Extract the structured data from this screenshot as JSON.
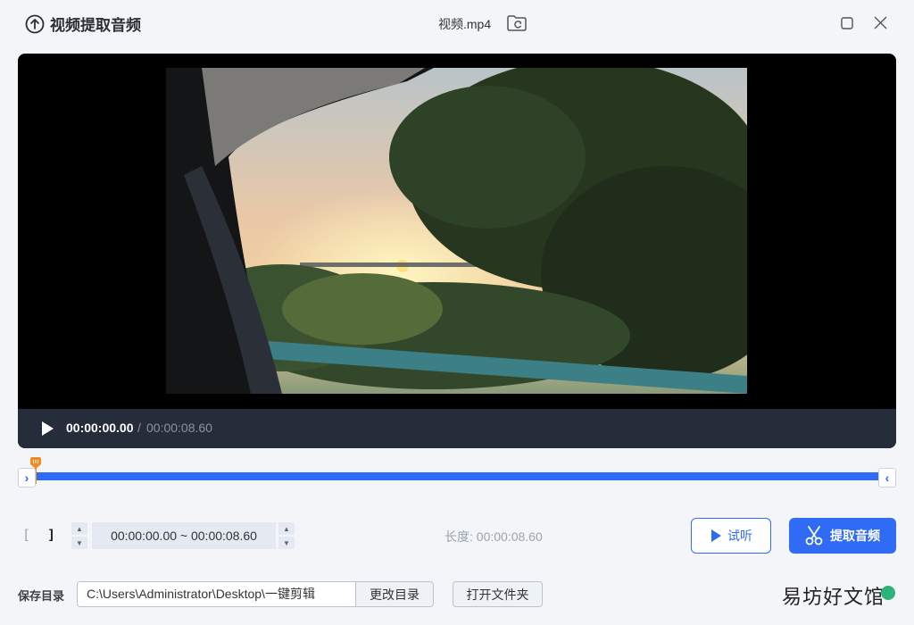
{
  "app": {
    "title": "视频提取音频",
    "file_name": "视频.mp4",
    "icons": {
      "title": "upload-circle-icon",
      "folder": "folder-refresh-icon",
      "maximize": "maximize-icon",
      "close": "close-icon"
    }
  },
  "player": {
    "current_time": "00:00:00.00",
    "separator": "/",
    "total_time": "00:00:08.60",
    "play_icon": "play-icon"
  },
  "timeline": {
    "start_handle": "›",
    "end_handle": "‹",
    "marker_icon": "playhead-marker-icon",
    "track_color": "#2f6bf4",
    "marker_color": "#f08a24"
  },
  "range": {
    "start_bracket": "[",
    "end_bracket": "]",
    "value": "00:00:00.00 ~ 00:00:08.60",
    "length_label": "长度: 00:00:08.60"
  },
  "actions": {
    "preview_label": "试听",
    "extract_label": "提取音频",
    "preview_icon": "play-outline-icon",
    "extract_icon": "scissors-icon"
  },
  "save": {
    "label": "保存目录",
    "path": "C:\\Users\\Administrator\\Desktop\\一键剪辑",
    "change_button": "更改目录",
    "open_button": "打开文件夹"
  },
  "watermark": {
    "text": "易坊好文馆"
  },
  "colors": {
    "accent": "#2f6bf4",
    "background": "#f3f5f9",
    "control_bar": "#252d3a"
  }
}
